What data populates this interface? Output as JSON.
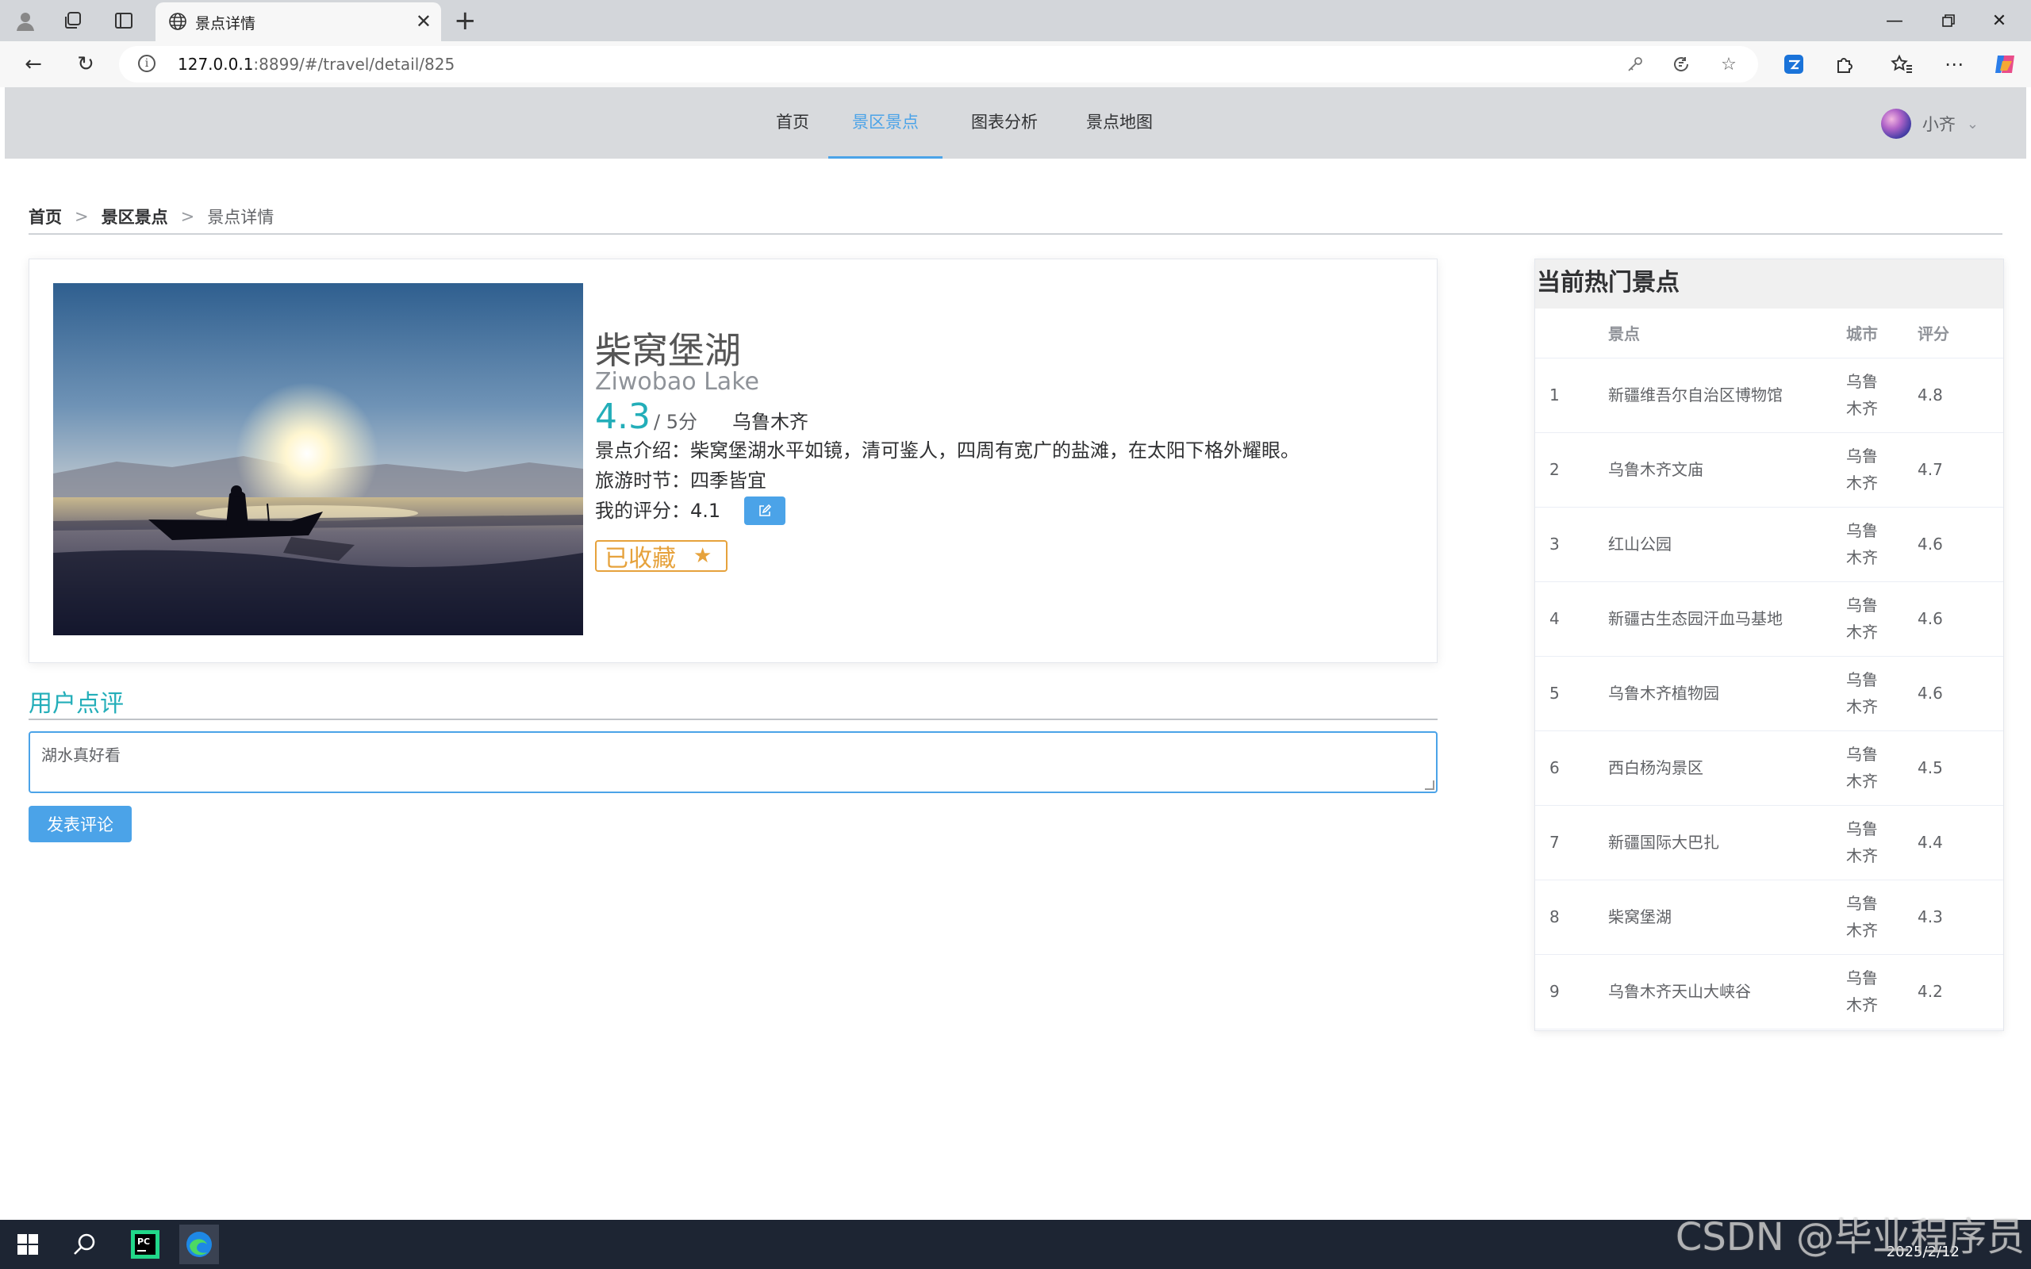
{
  "browser": {
    "tab_title": "景点详情",
    "url_host": "127.0.0.1",
    "url_rest": ":8899/#/travel/detail/825"
  },
  "nav": {
    "menu": [
      {
        "label": "首页"
      },
      {
        "label": "景区景点"
      },
      {
        "label": "图表分析"
      },
      {
        "label": "景点地图"
      }
    ],
    "active_index": 1,
    "username": "小齐"
  },
  "breadcrumb": [
    "首页",
    "景区景点",
    "景点详情"
  ],
  "detail": {
    "name_cn": "柴窝堡湖",
    "name_en": "Ziwobao Lake",
    "score": "4.3",
    "score_suffix": "/ 5分",
    "city": "乌鲁木齐",
    "intro_label": "景点介绍：",
    "intro": "柴窝堡湖水平如镜，清可鉴人，四周有宽广的盐滩，在太阳下格外耀眼。",
    "season_label": "旅游时节：",
    "season": "四季皆宜",
    "my_score_label": "我的评分：",
    "my_score": "4.1",
    "favorite_label": "已收藏"
  },
  "review": {
    "title": "用户点评",
    "text": "湖水真好看",
    "submit_label": "发表评论"
  },
  "hot": {
    "title": "当前热门景点",
    "columns": [
      "",
      "景点",
      "城市",
      "评分"
    ],
    "rows": [
      {
        "idx": "1",
        "name": "新疆维吾尔自治区博物馆",
        "city": "乌鲁木齐",
        "score": "4.8"
      },
      {
        "idx": "2",
        "name": "乌鲁木齐文庙",
        "city": "乌鲁木齐",
        "score": "4.7"
      },
      {
        "idx": "3",
        "name": "红山公园",
        "city": "乌鲁木齐",
        "score": "4.6"
      },
      {
        "idx": "4",
        "name": "新疆古生态园汗血马基地",
        "city": "乌鲁木齐",
        "score": "4.6"
      },
      {
        "idx": "5",
        "name": "乌鲁木齐植物园",
        "city": "乌鲁木齐",
        "score": "4.6"
      },
      {
        "idx": "6",
        "name": "西白杨沟景区",
        "city": "乌鲁木齐",
        "score": "4.5"
      },
      {
        "idx": "7",
        "name": "新疆国际大巴扎",
        "city": "乌鲁木齐",
        "score": "4.4"
      },
      {
        "idx": "8",
        "name": "柴窝堡湖",
        "city": "乌鲁木齐",
        "score": "4.3"
      },
      {
        "idx": "9",
        "name": "乌鲁木齐天山大峡谷",
        "city": "乌鲁木齐",
        "score": "4.2"
      }
    ]
  },
  "taskbar": {
    "date": "2025/2/12",
    "watermark": "CSDN @毕业程序员"
  },
  "colors": {
    "accent": "#4ba3e8",
    "score": "#23aeb9",
    "favorite": "#e6a23c"
  }
}
